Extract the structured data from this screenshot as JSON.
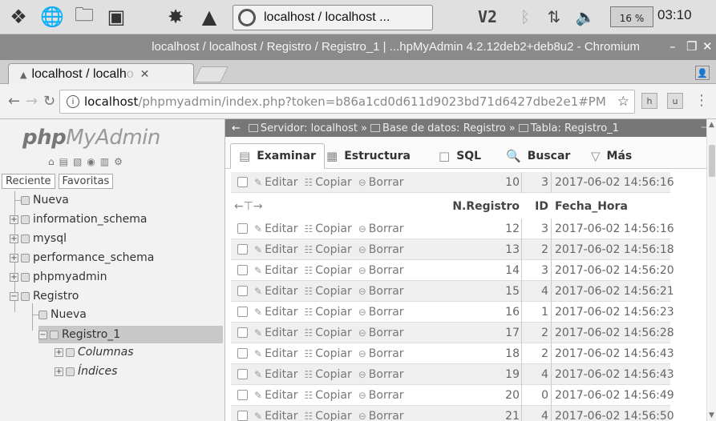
{
  "taskbar": {
    "task_title": "localhost / localhost ...",
    "cpu": "16 %",
    "clock": "03:10"
  },
  "window": {
    "title": "localhost / localhost / Registro / Registro_1 | ...hpMyAdmin 4.2.12deb2+deb8u2 - Chromium"
  },
  "browser": {
    "tab_title_a": "localhost / localh",
    "tab_title_b": "o",
    "url_host": "localhost",
    "url_path": "/phpmyadmin/index.php?token=b86a1cd0d611d9023bd71d6427dbe2e1#PM"
  },
  "sidebar": {
    "logo_a": "php",
    "logo_b": "MyAdmin",
    "recent": "Reciente",
    "favorites": "Favoritas",
    "tree": {
      "new": "Nueva",
      "information_schema": "information_schema",
      "mysql": "mysql",
      "performance_schema": "performance_schema",
      "phpmyadmin": "phpmyadmin",
      "registro": "Registro",
      "registro_new": "Nueva",
      "registro_1": "Registro_1",
      "columns": "Columnas",
      "indexes": "Índices"
    }
  },
  "breadcrumb": {
    "server": "Servidor: localhost",
    "database": "Base de datos: Registro",
    "table": "Tabla: Registro_1"
  },
  "tabs": {
    "browse": "Examinar",
    "structure": "Estructura",
    "sql": "SQL",
    "search": "Buscar",
    "more": "Más"
  },
  "actions": {
    "edit": "Editar",
    "copy": "Copiar",
    "delete": "Borrar"
  },
  "columns": {
    "nreg": "N.Registro",
    "id": "ID",
    "datetime": "Fecha_Hora"
  },
  "rows": [
    {
      "n": "10",
      "id": "3",
      "dt": "2017-06-02 14:56:16"
    },
    {
      "n": "12",
      "id": "3",
      "dt": "2017-06-02 14:56:16"
    },
    {
      "n": "13",
      "id": "2",
      "dt": "2017-06-02 14:56:18"
    },
    {
      "n": "14",
      "id": "3",
      "dt": "2017-06-02 14:56:20"
    },
    {
      "n": "15",
      "id": "4",
      "dt": "2017-06-02 14:56:21"
    },
    {
      "n": "16",
      "id": "1",
      "dt": "2017-06-02 14:56:23"
    },
    {
      "n": "17",
      "id": "2",
      "dt": "2017-06-02 14:56:28"
    },
    {
      "n": "18",
      "id": "2",
      "dt": "2017-06-02 14:56:43"
    },
    {
      "n": "19",
      "id": "4",
      "dt": "2017-06-02 14:56:43"
    },
    {
      "n": "20",
      "id": "0",
      "dt": "2017-06-02 14:56:49"
    },
    {
      "n": "21",
      "id": "4",
      "dt": "2017-06-02 14:56:50"
    }
  ]
}
